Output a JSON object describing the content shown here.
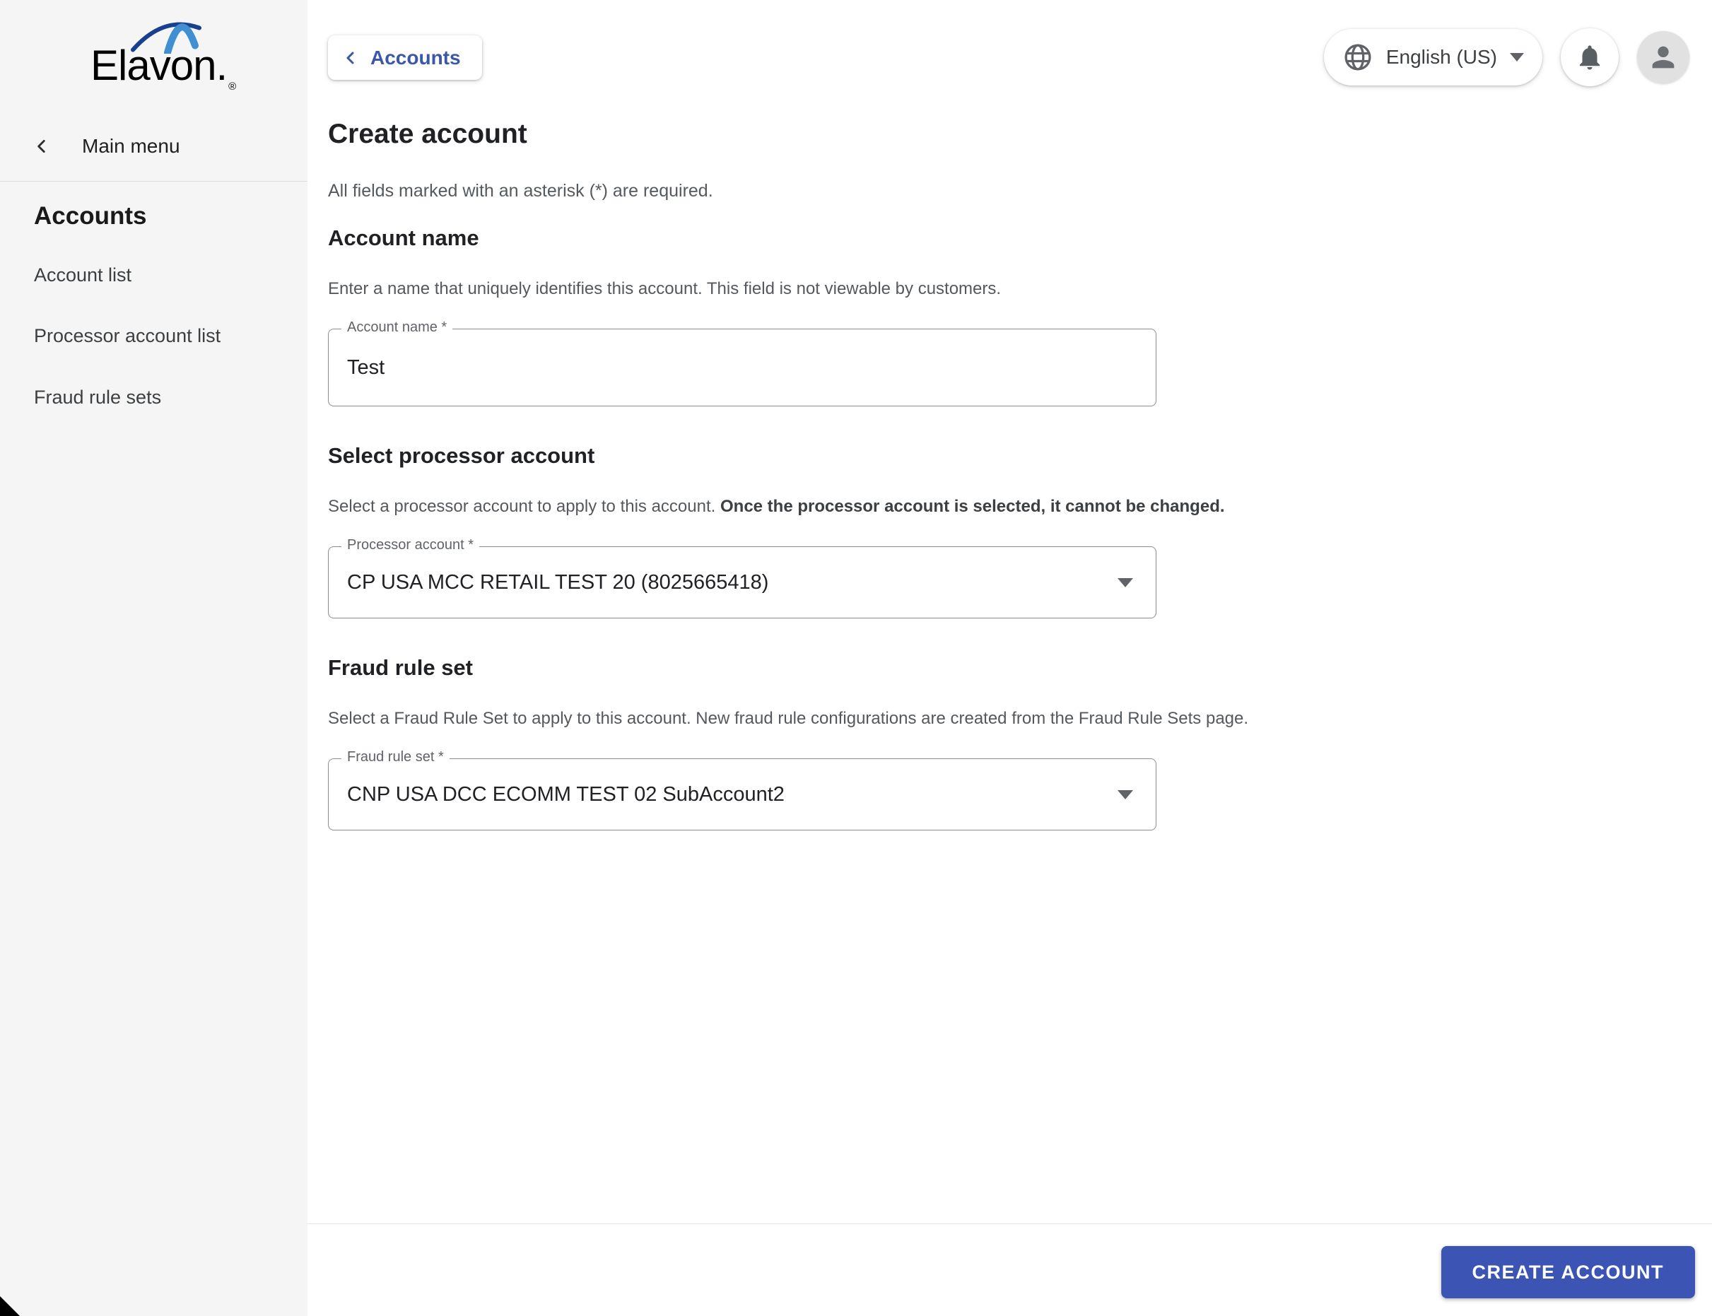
{
  "brand": {
    "logo_text": "Elavon.",
    "trademark": "®"
  },
  "sidebar": {
    "back_label": "Main menu",
    "section_title": "Accounts",
    "items": [
      {
        "label": "Account list"
      },
      {
        "label": "Processor account list"
      },
      {
        "label": "Fraud rule sets"
      }
    ]
  },
  "topbar": {
    "back_label": "Accounts",
    "language_label": "English (US)"
  },
  "page": {
    "title": "Create account",
    "required_note": "All fields marked with an asterisk (*) are required.",
    "sections": [
      {
        "heading": "Account name",
        "description": "Enter a name that uniquely identifies this account. This field is not viewable by customers.",
        "field": {
          "label": "Account name *",
          "value": "Test",
          "type": "text"
        }
      },
      {
        "heading": "Select processor account",
        "description": "Select a processor account to apply to this account. ",
        "description_bold": "Once the processor account is selected, it cannot be changed.",
        "field": {
          "label": "Processor account *",
          "value": "CP USA MCC RETAIL TEST 20 (8025665418)",
          "type": "select"
        }
      },
      {
        "heading": "Fraud rule set",
        "description": "Select a Fraud Rule Set to apply to this account. New fraud rule configurations are created from the Fraud Rule Sets page.",
        "field": {
          "label": "Fraud rule set *",
          "value": "CNP USA DCC ECOMM TEST 02 SubAccount2",
          "type": "select"
        }
      }
    ]
  },
  "footer": {
    "create_button_label": "CREATE ACCOUNT"
  },
  "icons": {
    "globe": "globe-icon",
    "bell": "bell-icon",
    "person": "person-icon",
    "chevron_left": "chevron-left-icon",
    "dropdown_caret": "chevron-down-icon"
  },
  "colors": {
    "accent_link_blue": "#3a57a9",
    "button_blue": "#3c55b4",
    "sidebar_bg": "#f5f5f5",
    "icon_gray": "#5f6368",
    "logo_navy": "#17418e",
    "logo_light_blue": "#3f8fd2"
  }
}
